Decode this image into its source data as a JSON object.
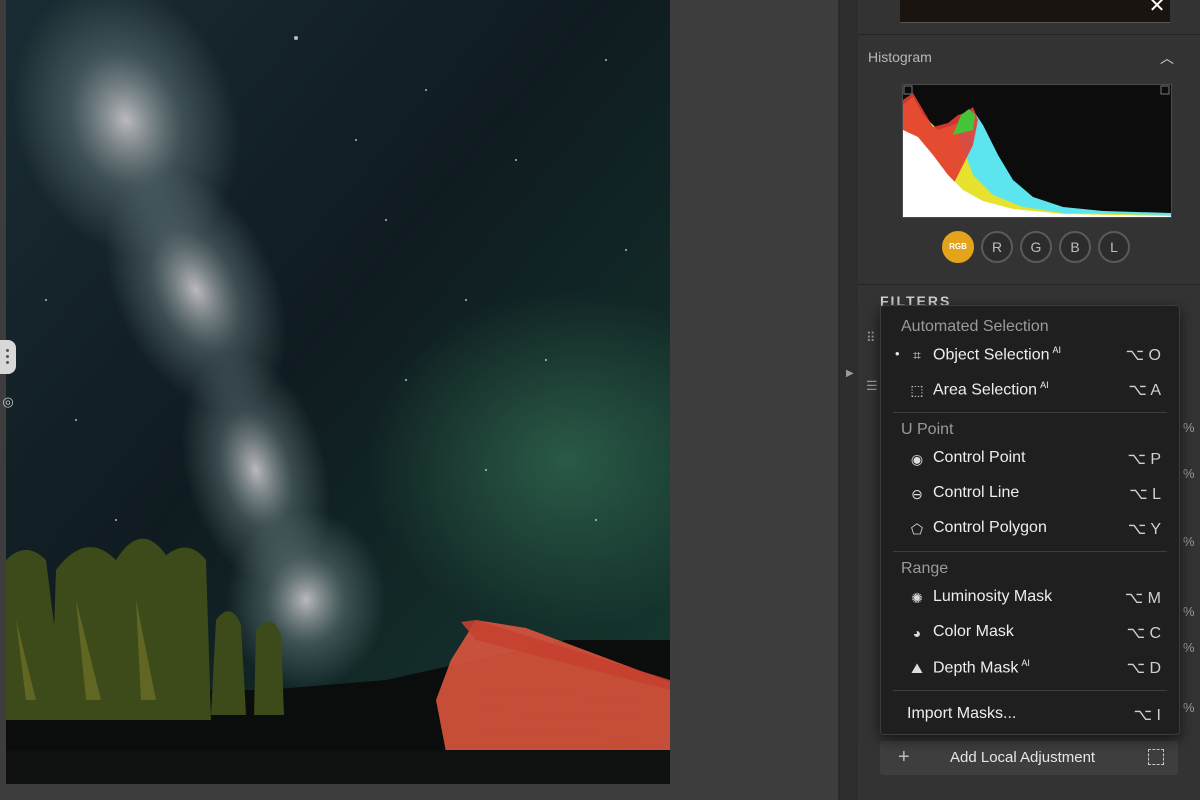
{
  "histogram": {
    "title": "Histogram",
    "channels": [
      "RGB",
      "R",
      "G",
      "B",
      "L"
    ],
    "active_channel": "RGB"
  },
  "filters": {
    "title": "FILTERS"
  },
  "menu": {
    "automated": {
      "title": "Automated Selection",
      "object_selection": {
        "label": "Object Selection",
        "badge": "AI",
        "shortcut": "⌥ O",
        "selected": true
      },
      "area_selection": {
        "label": "Area Selection",
        "badge": "AI",
        "shortcut": "⌥ A"
      }
    },
    "upoint": {
      "title": "U Point",
      "control_point": {
        "label": "Control Point",
        "shortcut": "⌥ P"
      },
      "control_line": {
        "label": "Control Line",
        "shortcut": "⌥ L"
      },
      "control_polygon": {
        "label": "Control Polygon",
        "shortcut": "⌥ Y"
      }
    },
    "range": {
      "title": "Range",
      "luminosity_mask": {
        "label": "Luminosity Mask",
        "shortcut": "⌥ M"
      },
      "color_mask": {
        "label": "Color Mask",
        "shortcut": "⌥ C"
      },
      "depth_mask": {
        "label": "Depth Mask",
        "badge": "AI",
        "shortcut": "⌥ D"
      }
    },
    "import_masks": {
      "label": "Import Masks...",
      "shortcut": "⌥ I"
    }
  },
  "add_local_adjustment": {
    "label": "Add Local Adjustment"
  },
  "colors": {
    "accent": "#e3a31a",
    "mask_overlay": "#e0563f",
    "panel_bg": "#333333",
    "menu_bg": "#1f1f1f"
  }
}
